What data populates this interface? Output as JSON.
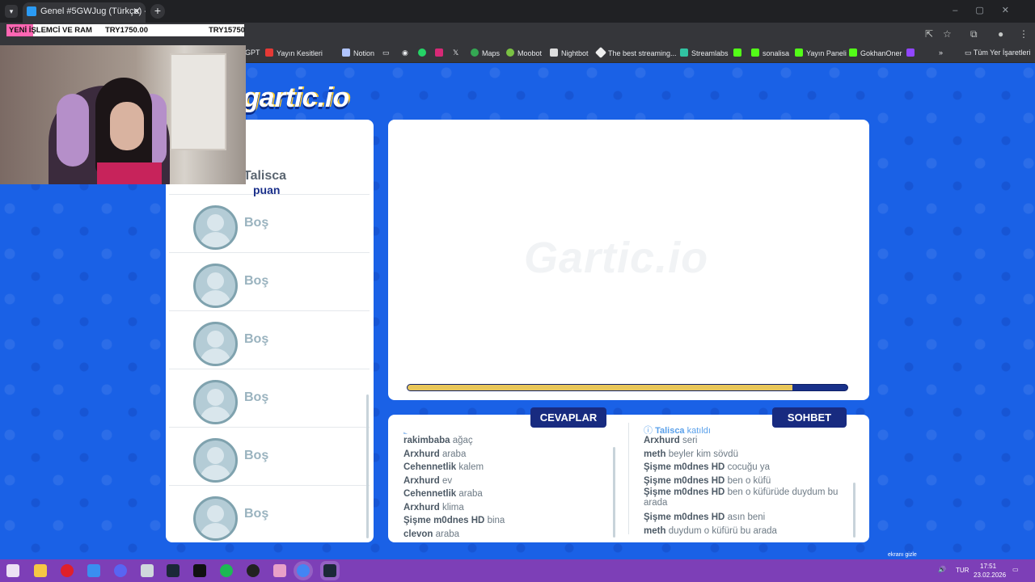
{
  "browser": {
    "tab_title": "Genel #5GWJug (Türkçe) - Gartic",
    "bookmarks": [
      "GPT",
      "Yayın Kesitleri",
      "Notion",
      "Maps",
      "Moobot",
      "Nightbot",
      "The best streaming...",
      "Streamlabs",
      "sonalisa",
      "Yayın Paneli",
      "GokhanOner",
      "Tüm Yer İşaretleri"
    ]
  },
  "ticker": {
    "label": "YENİ İŞLEMCİ VE RAM",
    "current": "TRY1750.00",
    "goal": "TRY15750"
  },
  "game": {
    "logo": "gartic.io",
    "watermark": "Gartic.io",
    "progress_fraction": 0.875,
    "players": {
      "first": {
        "name": "Talisca",
        "points_label": "puan"
      },
      "empty": [
        "Boş",
        "Boş",
        "Boş",
        "Boş",
        "Boş",
        "Boş"
      ]
    },
    "answers_title": "CEVAPLAR",
    "chat_title": "SOHBET",
    "answers": [
      {
        "user": "rakimbaba",
        "text": "ağaç"
      },
      {
        "user": "Arxhurd",
        "text": "araba"
      },
      {
        "user": "Cehennetlik",
        "text": "kalem"
      },
      {
        "user": "Arxhurd",
        "text": "ev"
      },
      {
        "user": "Cehennetlik",
        "text": "araba"
      },
      {
        "user": "Arxhurd",
        "text": "klima"
      },
      {
        "user": "Şişme m0dnes HD",
        "text": "bina"
      },
      {
        "user": "clevon",
        "text": "araba"
      }
    ],
    "chat_join": {
      "user": "Talisca",
      "text": "katıldı"
    },
    "chat": [
      {
        "user": "Arxhurd",
        "text": "seri"
      },
      {
        "user": "meth",
        "text": "beyler kim sövdü"
      },
      {
        "user": "Şişme m0dnes HD",
        "text": "cocuğu ya"
      },
      {
        "user": "Şişme m0dnes HD",
        "text": "ben o küfü"
      },
      {
        "user": "Şişme m0dnes HD",
        "text": "ben o küfürüde duydum bu arada"
      },
      {
        "user": "Şişme m0dnes HD",
        "text": "asın beni"
      },
      {
        "user": "meth",
        "text": "duydum o küfürü bu arada"
      }
    ]
  },
  "system": {
    "overlay_note": "ekranı gizle",
    "lang": "TUR",
    "time": "17:51",
    "date": "23.02.2026"
  },
  "colors": {
    "page_bg": "#1a61e6",
    "pill": "#182b80",
    "taskbar": "#7d3fb7",
    "progress_fill": "#e8c65a"
  }
}
